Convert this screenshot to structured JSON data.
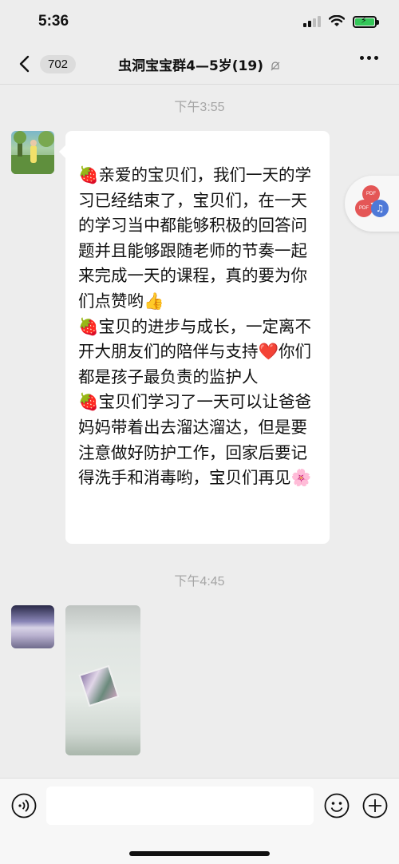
{
  "status_bar": {
    "time": "5:36"
  },
  "nav": {
    "back_count": "702",
    "title": "虫洞宝宝群4—5岁(19)"
  },
  "messages": [
    {
      "timestamp": "下午3:55",
      "text": "🍓亲爱的宝贝们，我们一天的学习已经结束了，宝贝们，在一天的学习当中都能够积极的回答问题并且能够跟随老师的节奏一起来完成一天的课程，真的要为你们点赞哟👍\n🍓宝贝的进步与成长，一定离不开大朋友们的陪伴与支持❤️你们都是孩子最负责的监护人\n🍓宝贝们学习了一天可以让爸爸妈妈带着出去溜达溜达，但是要注意做好防护工作，回家后要记得洗手和消毒哟，宝贝们再见🌸"
    },
    {
      "timestamp": "下午4:45",
      "type": "image"
    }
  ],
  "floating_widget": {
    "badge_a": "PDF",
    "badge_b": "PDF",
    "icon": "music-note-icon"
  },
  "input": {
    "value": "",
    "placeholder": ""
  },
  "colors": {
    "background": "#ededed",
    "bubble": "#ffffff",
    "timestamp": "#a6a6a6"
  }
}
